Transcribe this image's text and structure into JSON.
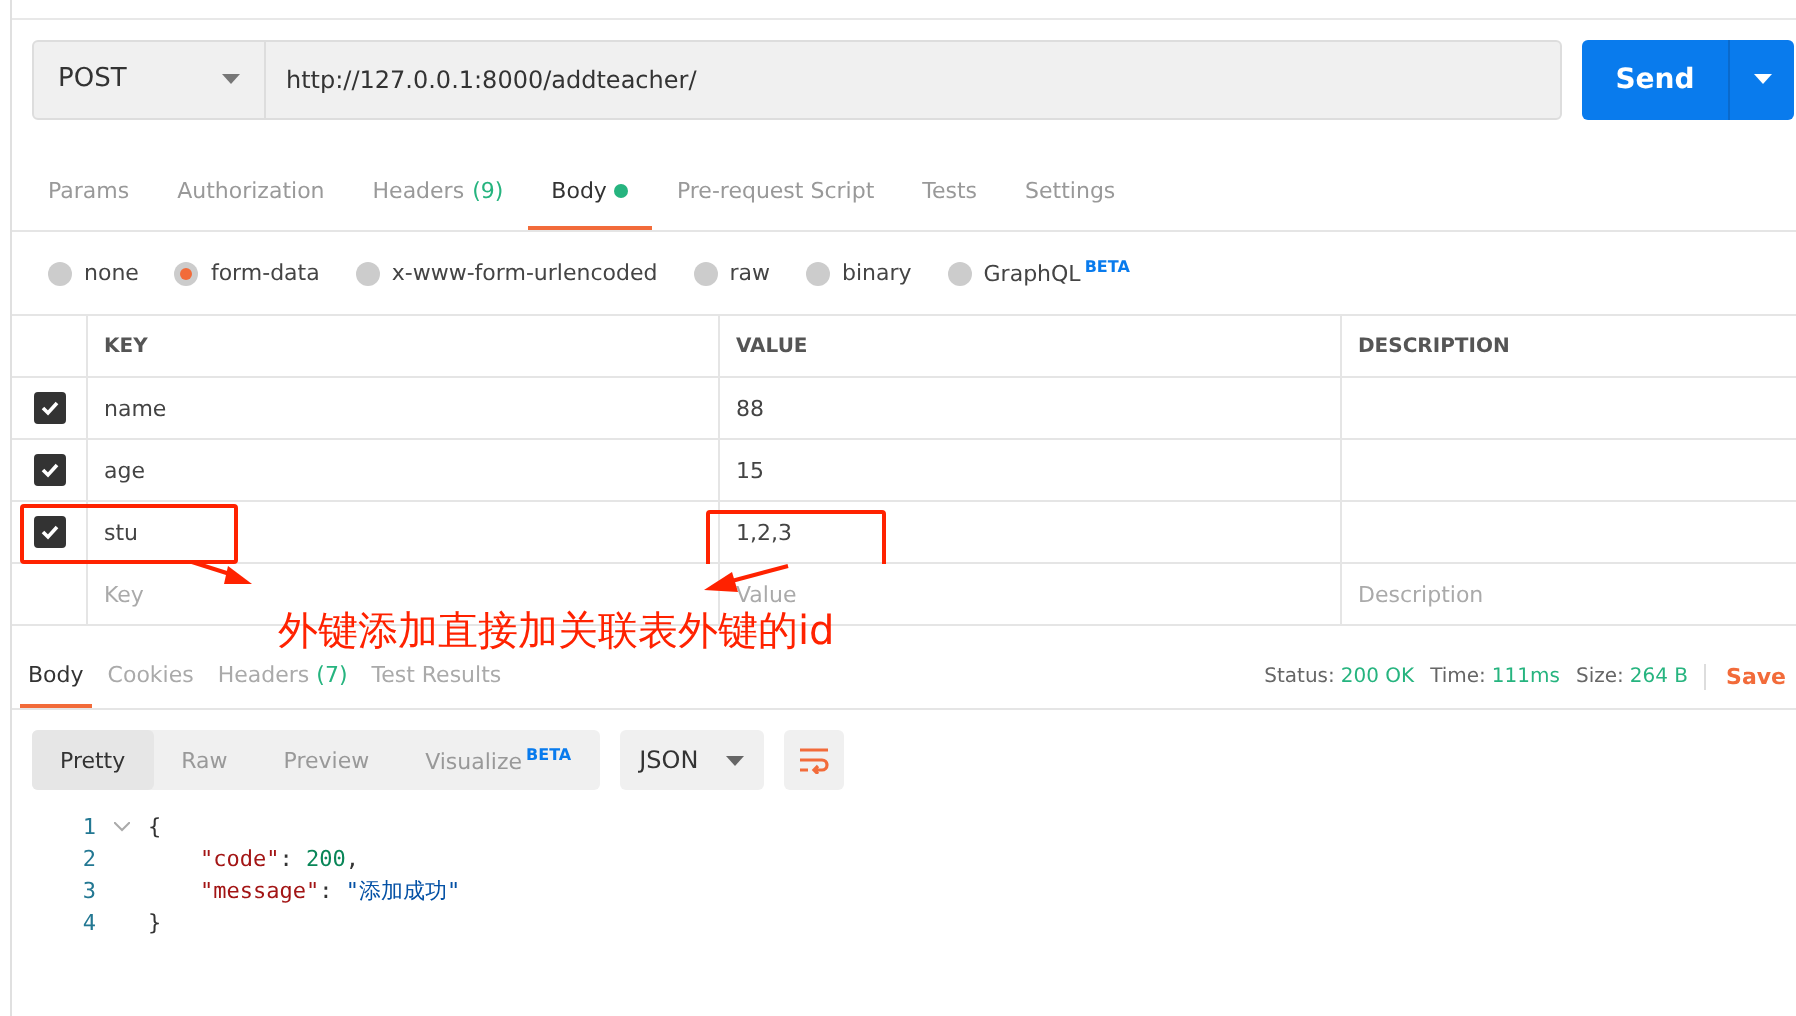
{
  "request": {
    "method": "POST",
    "url": "http://127.0.0.1:8000/addteacher/",
    "send": "Send"
  },
  "request_tabs": [
    {
      "label": "Params",
      "selected": false
    },
    {
      "label": "Authorization",
      "selected": false
    },
    {
      "label": "Headers",
      "count": "(9)",
      "selected": false
    },
    {
      "label": "Body",
      "selected": true,
      "modified": true
    },
    {
      "label": "Pre-request Script",
      "selected": false
    },
    {
      "label": "Tests",
      "selected": false
    },
    {
      "label": "Settings",
      "selected": false
    }
  ],
  "body_types": [
    {
      "label": "none",
      "selected": false
    },
    {
      "label": "form-data",
      "selected": true
    },
    {
      "label": "x-www-form-urlencoded",
      "selected": false
    },
    {
      "label": "raw",
      "selected": false
    },
    {
      "label": "binary",
      "selected": false
    },
    {
      "label": "GraphQL",
      "badge": "BETA",
      "selected": false
    }
  ],
  "params": {
    "columns": [
      "KEY",
      "VALUE",
      "DESCRIPTION"
    ],
    "rows": [
      {
        "key": "name",
        "value": "88",
        "checked": true,
        "highlighted": false
      },
      {
        "key": "age",
        "value": "15",
        "checked": true,
        "highlighted": false
      },
      {
        "key": "stu",
        "value": "1,2,3",
        "checked": true,
        "highlighted": true
      }
    ],
    "new_row": [
      {
        "placeholder": "Key"
      },
      {
        "placeholder": "Value"
      },
      {
        "placeholder": "Description"
      }
    ]
  },
  "annotation": {
    "text": "外键添加直接加关联表外键的id"
  },
  "response": {
    "tabs": [
      {
        "label": "Body",
        "selected": true
      },
      {
        "label": "Cookies",
        "selected": false
      },
      {
        "label": "Headers",
        "count": "(7)",
        "selected": false
      },
      {
        "label": "Test Results",
        "selected": false
      }
    ],
    "stats": [
      {
        "label": "Status:",
        "value": "200 OK"
      },
      {
        "label": "Time:",
        "value": "111ms"
      },
      {
        "label": "Size:",
        "value": "264 B"
      }
    ],
    "save": "Save",
    "view_modes": [
      {
        "label": "Pretty",
        "selected": true
      },
      {
        "label": "Raw",
        "selected": false
      },
      {
        "label": "Preview",
        "selected": false
      },
      {
        "label": "Visualize",
        "badge": "BETA",
        "selected": false
      }
    ],
    "format": "JSON",
    "code": [
      {
        "number": "1",
        "foldable": true,
        "indented": false,
        "tokens": [
          {
            "kind": "punct",
            "text": "{"
          }
        ]
      },
      {
        "number": "2",
        "foldable": false,
        "indented": true,
        "tokens": [
          {
            "kind": "key",
            "text": "\"code\""
          },
          {
            "kind": "punct",
            "text": ": "
          },
          {
            "kind": "number",
            "text": "200"
          },
          {
            "kind": "punct",
            "text": ","
          }
        ]
      },
      {
        "number": "3",
        "foldable": false,
        "indented": true,
        "tokens": [
          {
            "kind": "key",
            "text": "\"message\""
          },
          {
            "kind": "punct",
            "text": ": "
          },
          {
            "kind": "string",
            "text": "\"添加成功\""
          }
        ]
      },
      {
        "number": "4",
        "foldable": false,
        "indented": false,
        "tokens": [
          {
            "kind": "punct",
            "text": "}"
          }
        ]
      }
    ]
  }
}
